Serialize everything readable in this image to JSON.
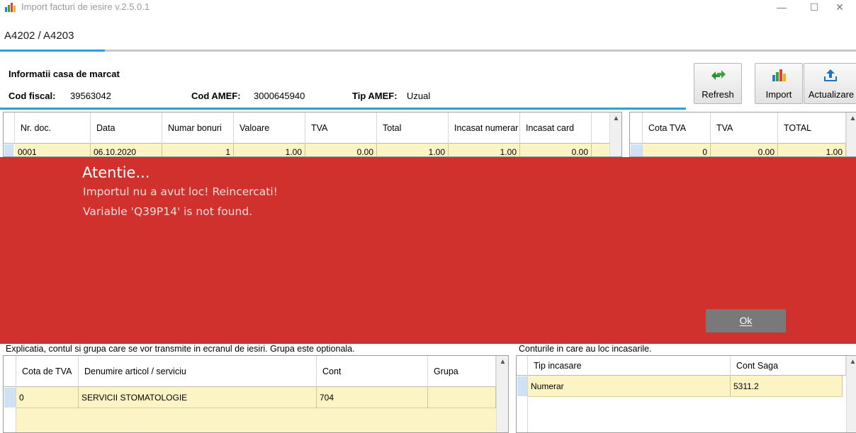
{
  "window": {
    "title": "Import facturi de iesire v.2.5.0.1",
    "minimize": "—",
    "maximize": "☐",
    "close": "✕"
  },
  "tab": {
    "label": "A4202 / A4203"
  },
  "info": {
    "title": "Informatii casa de marcat",
    "cod_fiscal_label": "Cod fiscal:",
    "cod_fiscal_value": "39563042",
    "cod_amef_label": "Cod AMEF:",
    "cod_amef_value": "3000645940",
    "tip_amef_label": "Tip AMEF:",
    "tip_amef_value": "Uzual"
  },
  "toolbar": {
    "refresh": "Refresh",
    "import": "Import",
    "update": "Actualizare"
  },
  "docs_grid": {
    "columns": [
      "Nr. doc.",
      "Data",
      "Numar bonuri",
      "Valoare",
      "TVA",
      "Total",
      "Incasat numerar",
      "Incasat card"
    ],
    "row": [
      "0001",
      "06.10.2020",
      "1",
      "1.00",
      "0.00",
      "1.00",
      "1.00",
      "0.00"
    ]
  },
  "vat_grid": {
    "columns": [
      "Cota TVA",
      "TVA",
      "TOTAL"
    ],
    "row": [
      "0",
      "0.00",
      "1.00"
    ]
  },
  "alert": {
    "title": "Atentie...",
    "line1": "Importul nu a avut loc! Reincercati!",
    "line2": "Variable 'Q39P14' is not found.",
    "ok": "Ok"
  },
  "bottom_left": {
    "caption": "Explicatia, contul si grupa care se vor transmite in ecranul de iesiri. Grupa este optionala.",
    "columns": [
      "Cota de TVA",
      "Denumire articol / serviciu",
      "Cont",
      "Grupa"
    ],
    "row": [
      "0",
      "SERVICII STOMATOLOGIE",
      "704",
      ""
    ]
  },
  "bottom_right": {
    "caption": "Conturile in care au loc incasarile.",
    "columns": [
      "Tip incasare",
      "Cont Saga"
    ],
    "row": [
      "Numerar",
      "5311.2"
    ]
  },
  "colors": {
    "accent": "#2aa0d8",
    "alert": "#d0312d",
    "row_highlight": "#fdf4c5"
  }
}
